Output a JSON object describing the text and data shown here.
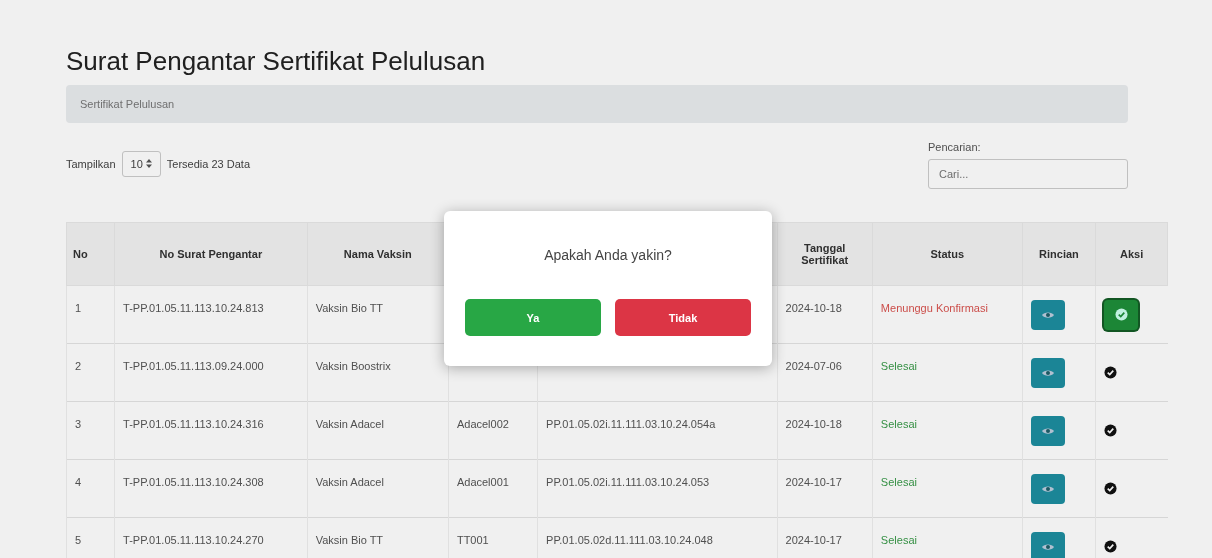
{
  "title": "Surat Pengantar Sertifikat Pelulusan",
  "breadcrumb": "Sertifikat Pelulusan",
  "length_control": {
    "label": "Tampilkan",
    "value": "10",
    "info": "Tersedia 23 Data"
  },
  "search": {
    "label": "Pencarian:",
    "placeholder": "Cari..."
  },
  "table": {
    "columns": [
      {
        "label": "No"
      },
      {
        "label": "No Surat Pengantar"
      },
      {
        "label": "Nama Vaksin"
      },
      {},
      {},
      {
        "label": "Tanggal Sertifikat"
      },
      {
        "label": "Status"
      },
      {
        "label": "Rincian"
      },
      {
        "label": "Aksi"
      }
    ],
    "rows": [
      {
        "no": "1",
        "letter_no": "T-PP.01.05.11.113.10.24.813",
        "vaccine": "Vaksin Bio TT",
        "date": "2024-10-18",
        "status": "Menunggu Konfirmasi",
        "color": "#d9534f",
        "action_active": true
      },
      {
        "no": "2",
        "letter_no": "T-PP.01.05.11.113.09.24.000",
        "vaccine": "Vaksin Boostrix",
        "date": "2024-07-06",
        "status": "Selesai",
        "color": "#3a9a4a",
        "action_active": false
      },
      {
        "no": "3",
        "letter_no": "T-PP.01.05.11.113.10.24.316",
        "vaccine": "Vaksin Adacel",
        "column_4": "Adacel002",
        "column_5": "PP.01.05.02i.11.111.03.10.24.054a",
        "date": "2024-10-18",
        "status": "Selesai",
        "color": "#3a9a4a",
        "action_active": false
      },
      {
        "no": "4",
        "letter_no": "T-PP.01.05.11.113.10.24.308",
        "vaccine": "Vaksin Adacel",
        "column_4": "Adacel001",
        "column_5": "PP.01.05.02i.11.111.03.10.24.053",
        "date": "2024-10-17",
        "status": "Selesai",
        "color": "#3a9a4a",
        "action_active": false
      },
      {
        "no": "5",
        "letter_no": "T-PP.01.05.11.113.10.24.270",
        "vaccine": "Vaksin Bio TT",
        "column_4": "TT001",
        "column_5": "PP.01.05.02d.11.111.03.10.24.048",
        "date": "2024-10-17",
        "status": "Selesai",
        "color": "#3a9a4a",
        "action_active": false
      }
    ]
  },
  "dialog": {
    "message": "Apakah Anda yakin?",
    "confirm": "Ya",
    "cancel": "Tidak"
  }
}
